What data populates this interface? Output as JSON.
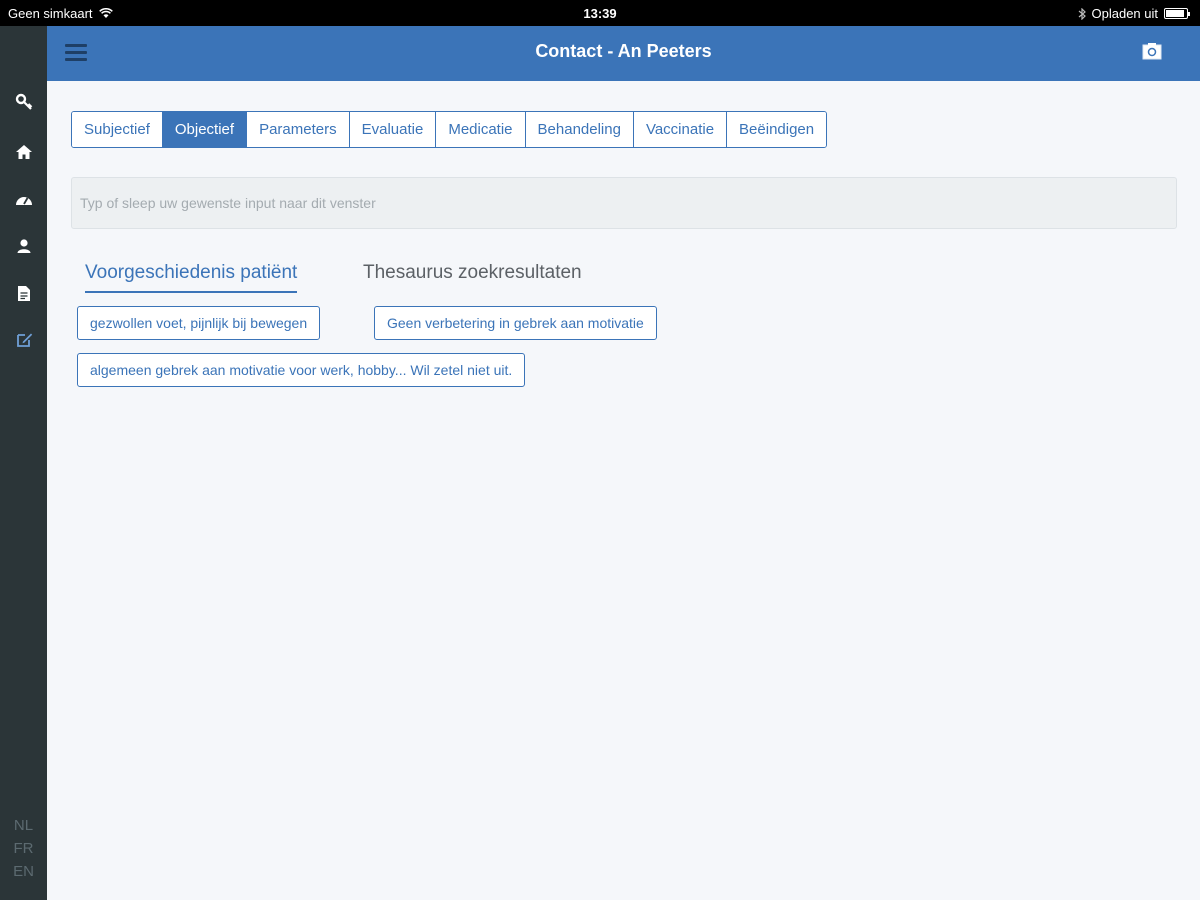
{
  "status_bar": {
    "carrier": "Geen simkaart",
    "time": "13:39",
    "charging": "Opladen uit",
    "battery_level": 0.9
  },
  "header": {
    "title": "Contact - An Peeters"
  },
  "sidebar": {
    "icons": [
      "key-icon",
      "home-icon",
      "dashboard-icon",
      "user-icon",
      "document-icon",
      "edit-icon"
    ],
    "languages": [
      "NL",
      "FR",
      "EN"
    ]
  },
  "tabs": [
    {
      "label": "Subjectief",
      "active": false
    },
    {
      "label": "Objectief",
      "active": true
    },
    {
      "label": "Parameters",
      "active": false
    },
    {
      "label": "Evaluatie",
      "active": false
    },
    {
      "label": "Medicatie",
      "active": false
    },
    {
      "label": "Behandeling",
      "active": false
    },
    {
      "label": "Vaccinatie",
      "active": false
    },
    {
      "label": "Beëindigen",
      "active": false
    }
  ],
  "input": {
    "placeholder": "Typ of sleep uw gewenste input naar dit venster",
    "value": ""
  },
  "subtabs": {
    "history": "Voorgeschiedenis patiënt",
    "thesaurus": "Thesaurus zoekresultaten"
  },
  "chips": [
    "gezwollen voet, pijnlijk bij bewegen",
    "Geen verbetering in gebrek aan motivatie",
    "algemeen gebrek aan motivatie voor werk, hobby... Wil zetel niet uit."
  ],
  "colors": {
    "accent": "#3b74b8",
    "sidebar": "#2b3538",
    "background": "#f5f7fa"
  }
}
